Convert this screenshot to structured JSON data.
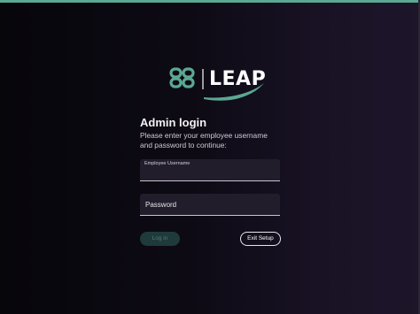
{
  "brand": {
    "name": "LEAP",
    "accent_color": "#5ba893",
    "logo_icon": "leap-logo-icon"
  },
  "login": {
    "title": "Admin login",
    "instructions": "Please enter your employee username and password to continue:"
  },
  "fields": {
    "username": {
      "label": "Employee Username",
      "value": ""
    },
    "password": {
      "label": "Password",
      "value": ""
    }
  },
  "buttons": {
    "login_label": "Log in",
    "exit_label": "Exit Setup"
  }
}
